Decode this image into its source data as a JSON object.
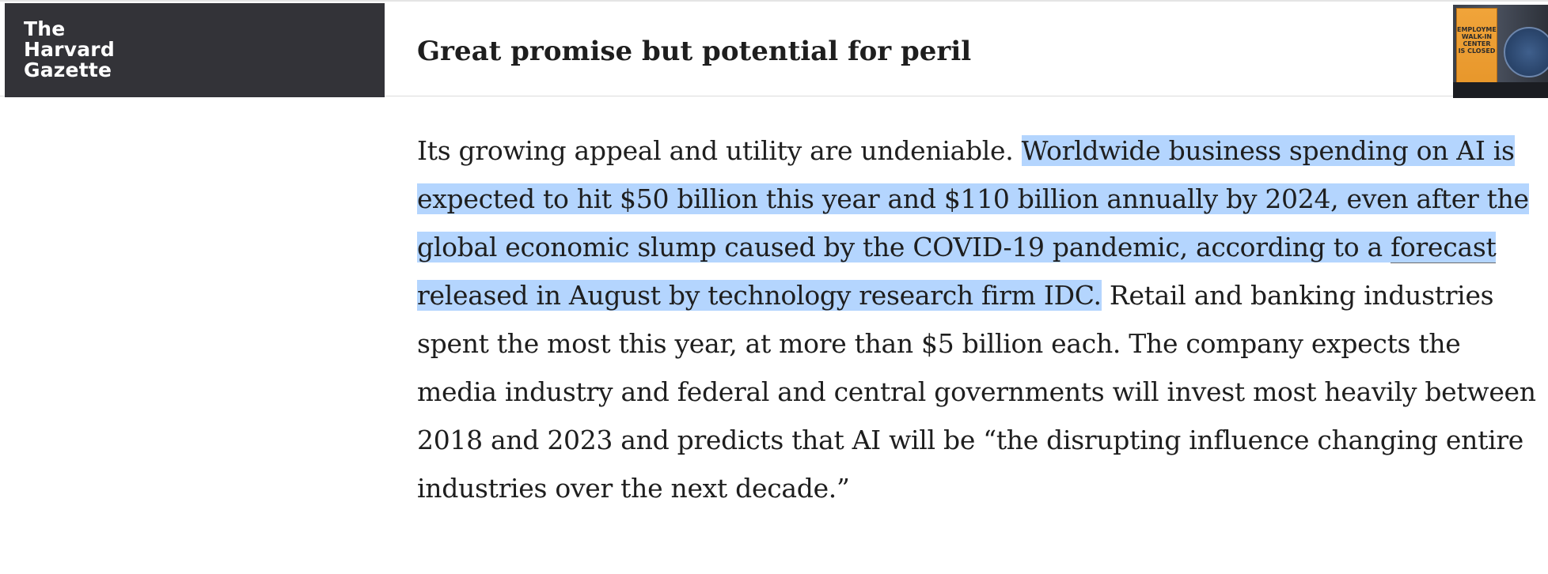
{
  "header": {
    "logo": {
      "line1": "The",
      "line2": "Harvard",
      "line3": "Gazette"
    },
    "headline": "Great promise but potential for peril",
    "thumbnail_sign": {
      "line1": "EMPLOYMENT",
      "line2": "WALK-IN CENTER",
      "line3": "IS CLOSED"
    }
  },
  "article": {
    "para1_intro": "Its growing appeal and utility are undeniable.",
    "para1_highlight_before_link": "Worldwide business spending on AI is expected to hit $50 billion this year and $110 billion annually by 2024, even after the global economic slump caused by the COVID-19 pandemic, according to a",
    "link_text": "forecast",
    "para1_highlight_after_link": "released in August by technology research firm IDC.",
    "para1_rest": "Retail and banking industries spent the most this year, at more than $5 billion each. The company expects the media industry and federal and central governments will invest most heavily between 2018 and 2023 and predicts that AI will be “the disrupting influence changing entire industries over the next decade.”"
  },
  "colors": {
    "logo_background": "#333338",
    "selection_highlight": "#b4d5fe",
    "text": "#1e1e1e"
  }
}
